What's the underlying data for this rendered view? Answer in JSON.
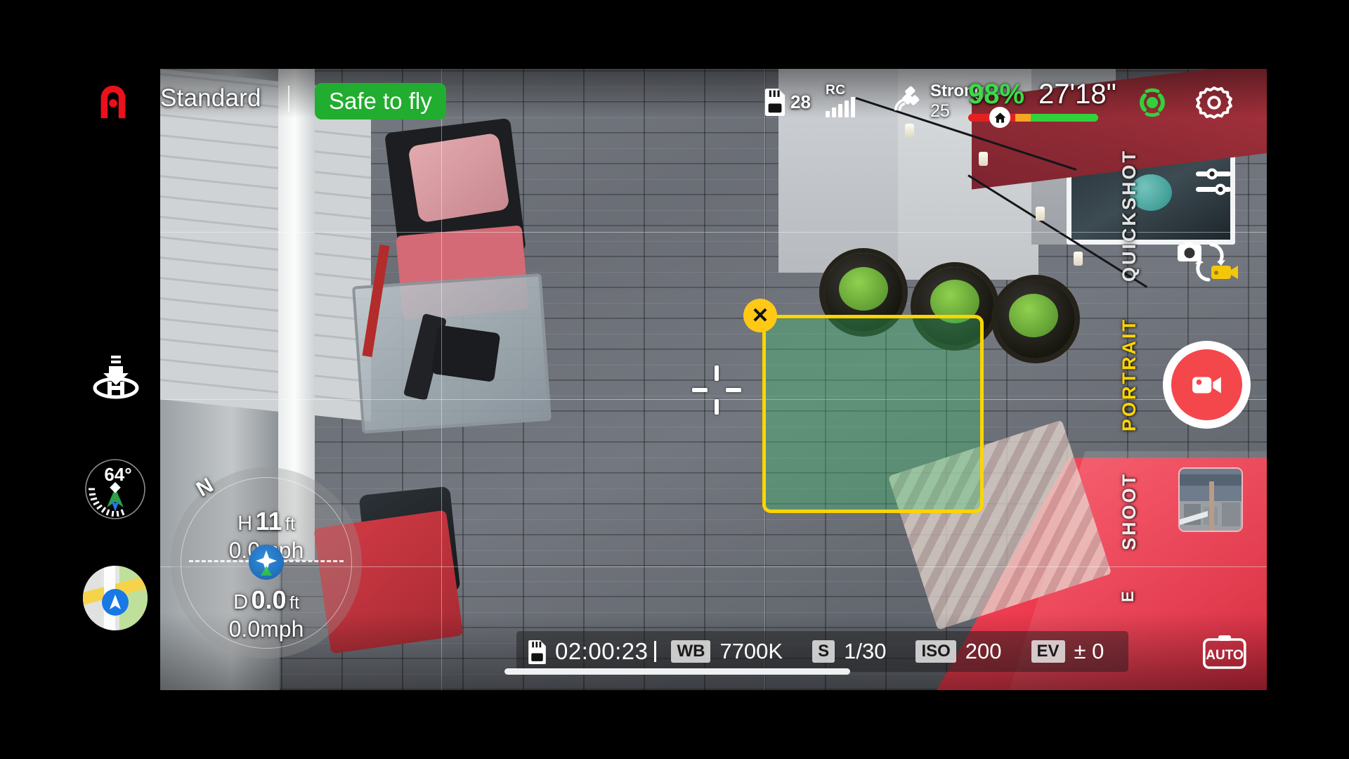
{
  "app": {
    "brand": "Autel",
    "logo_icon": "autel-logo-icon"
  },
  "topbar": {
    "flight_mode": "Standard",
    "status_badge": "Safe to fly",
    "status_color": "#21ad2f",
    "sd": {
      "icon": "sd-card-icon",
      "count": "28"
    },
    "rc": {
      "label": "RC",
      "icon": "signal-bars-icon",
      "bars_filled": 5,
      "bars_total": 5
    },
    "gps": {
      "icon": "satellite-icon",
      "strength": "Strong",
      "count": "25"
    },
    "battery": {
      "percent": "98%",
      "percent_color": "#3ddb47",
      "home_icon": "home-icon"
    },
    "flight_time": "27'18\"",
    "obstacle_avoidance_icon": "obstacle-avoidance-icon",
    "obstacle_avoidance_color": "#32d13c",
    "settings_icon": "gear-icon"
  },
  "left_rail": {
    "return_to_home_icon": "return-to-home-icon",
    "gimbal": {
      "icon": "gimbal-dial-icon",
      "degrees": "64°"
    },
    "map_icon": "map-navigation-icon"
  },
  "telemetry": {
    "compass_north": "N",
    "height": {
      "label": "H",
      "value": "11",
      "unit": "ft"
    },
    "height_speed": "0.0mph",
    "distance": {
      "label": "D",
      "value": "0.0",
      "unit": "ft"
    },
    "distance_speed": "0.0mph",
    "drone_icon": "drone-position-icon"
  },
  "viewfinder": {
    "tracking_box": {
      "color": "#ffd400",
      "close_icon": "close-x-icon"
    },
    "crosshair_icon": "center-crosshair-icon"
  },
  "right_rail": {
    "sliders_icon": "camera-sliders-icon",
    "camera_toggle_icon": "photo-video-toggle-icon",
    "modes": [
      {
        "label": "QUICKSHOT",
        "active": false
      },
      {
        "label": "PORTRAIT",
        "active": true
      },
      {
        "label": "SHOOT",
        "active": false
      },
      {
        "label": "E",
        "active": false
      }
    ],
    "record_button": {
      "icon": "video-record-icon",
      "color": "#f4474c"
    },
    "gallery_thumbnail": "gallery-thumbnail"
  },
  "camera_bar": {
    "sd_icon": "sd-card-icon",
    "rec_time": "02:00:23",
    "settings": [
      {
        "tag": "WB",
        "value": "7700K"
      },
      {
        "tag": "S",
        "value": "1/30"
      },
      {
        "tag": "ISO",
        "value": "200"
      },
      {
        "tag": "EV",
        "value": "± 0"
      }
    ],
    "auto_label": "AUTO",
    "auto_icon": "camera-auto-icon"
  }
}
